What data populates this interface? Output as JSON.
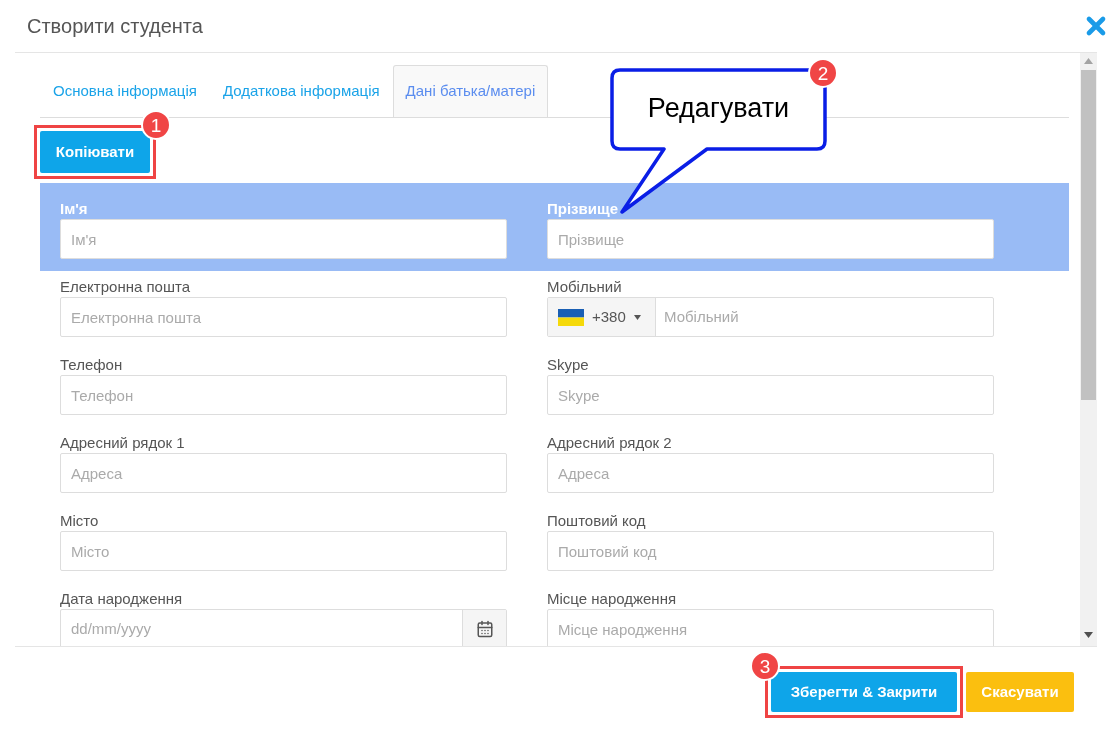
{
  "dialog": {
    "title": "Створити студента"
  },
  "tabs": [
    {
      "label": "Основна інформація",
      "selected": false
    },
    {
      "label": "Додаткова інформація",
      "selected": false
    },
    {
      "label": "Дані батька/матері",
      "selected": true
    }
  ],
  "copy_button": {
    "label": "Копіювати",
    "badge": "1"
  },
  "rows": [
    {
      "highlighted": true,
      "fields": [
        {
          "kind": "text",
          "label": "Ім'я",
          "placeholder": "Ім'я"
        },
        {
          "kind": "text",
          "label": "Прізвище",
          "placeholder": "Прізвище"
        }
      ]
    },
    {
      "highlighted": false,
      "fields": [
        {
          "kind": "text",
          "label": "Електронна пошта",
          "placeholder": "Електронна пошта"
        },
        {
          "kind": "phone",
          "label": "Мобільний",
          "code": "+380",
          "placeholder": "Мобільний"
        }
      ]
    },
    {
      "highlighted": false,
      "fields": [
        {
          "kind": "text",
          "label": "Телефон",
          "placeholder": "Телефон"
        },
        {
          "kind": "text",
          "label": "Skype",
          "placeholder": "Skype"
        }
      ]
    },
    {
      "highlighted": false,
      "fields": [
        {
          "kind": "text",
          "label": "Адресний рядок 1",
          "placeholder": "Адреса"
        },
        {
          "kind": "text",
          "label": "Адресний рядок 2",
          "placeholder": "Адреса"
        }
      ]
    },
    {
      "highlighted": false,
      "fields": [
        {
          "kind": "text",
          "label": "Місто",
          "placeholder": "Місто"
        },
        {
          "kind": "text",
          "label": "Поштовий код",
          "placeholder": "Поштовий код"
        }
      ]
    },
    {
      "highlighted": false,
      "fields": [
        {
          "kind": "date",
          "label": "Дата народження",
          "placeholder": "dd/mm/yyyy"
        },
        {
          "kind": "text",
          "label": "Місце народження",
          "placeholder": "Місце народження"
        }
      ]
    }
  ],
  "callout": {
    "text": "Редагувати",
    "badge": "2"
  },
  "footer_buttons": [
    {
      "kind": "primary",
      "label": "Зберегти & Закрити",
      "badge": "3"
    },
    {
      "kind": "warning",
      "label": "Скасувати"
    }
  ]
}
